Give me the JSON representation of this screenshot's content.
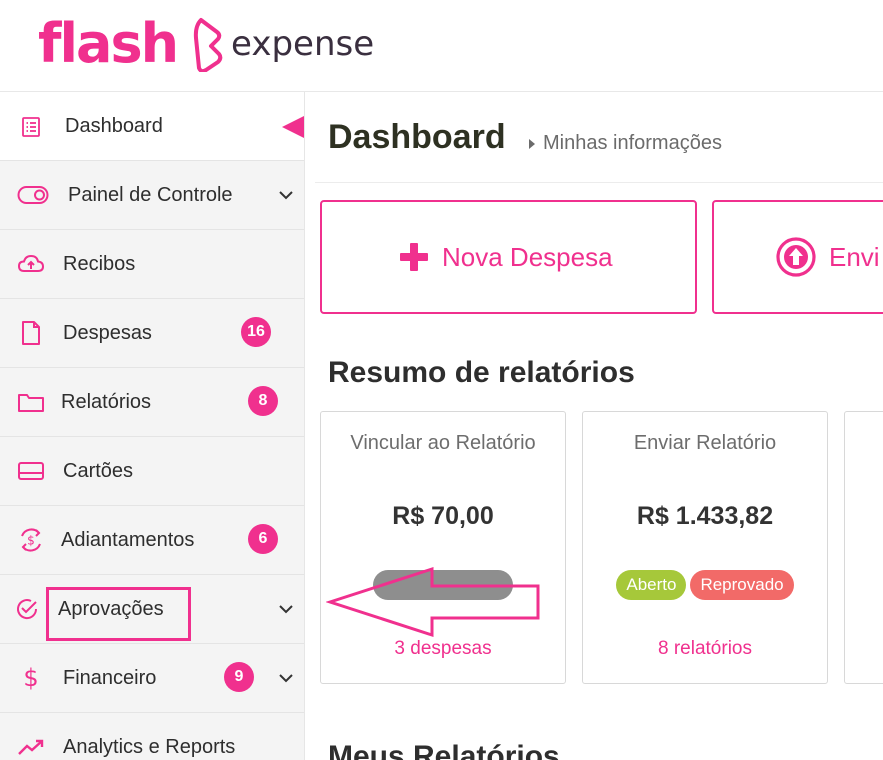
{
  "brand": {
    "name": "flash",
    "product": "expense",
    "color": "#f0308e"
  },
  "sidebar": {
    "items": [
      {
        "label": "Dashboard",
        "icon": "list-document-icon",
        "active": true
      },
      {
        "label": "Painel de Controle",
        "icon": "toggle-icon",
        "chevron": true
      },
      {
        "label": "Recibos",
        "icon": "cloud-upload-icon"
      },
      {
        "label": "Despesas",
        "icon": "file-icon",
        "badge": "16"
      },
      {
        "label": "Relatórios",
        "icon": "folder-icon",
        "badge": "8"
      },
      {
        "label": "Cartões",
        "icon": "credit-card-icon"
      },
      {
        "label": "Adiantamentos",
        "icon": "dollar-cycle-icon",
        "badge": "6"
      },
      {
        "label": "Aprovações",
        "icon": "check-circle-icon",
        "chevron": true
      },
      {
        "label": "Financeiro",
        "icon": "dollar-icon",
        "badge": "9",
        "chevron": true
      },
      {
        "label": "Analytics e Reports",
        "icon": "trending-up-icon"
      }
    ]
  },
  "header": {
    "title": "Dashboard",
    "breadcrumb": "Minhas informações"
  },
  "actions": {
    "new_expense": "Nova Despesa",
    "send": "Envi"
  },
  "summary": {
    "title": "Resumo de relatórios",
    "cards": [
      {
        "title": "Vincular ao Relatório",
        "amount": "R$ 70,00",
        "link": "3 despesas"
      },
      {
        "title": "Enviar Relatório",
        "amount": "R$ 1.433,82",
        "badges": [
          "Aberto",
          "Reprovado"
        ],
        "link": "8 relatórios"
      }
    ]
  },
  "my_reports": {
    "title": "Meus Relatórios"
  },
  "colors": {
    "accent": "#f0308e",
    "badge_open": "#a6c83a",
    "badge_rejected": "#f26a68",
    "badge_grey": "#8e8e8e"
  }
}
